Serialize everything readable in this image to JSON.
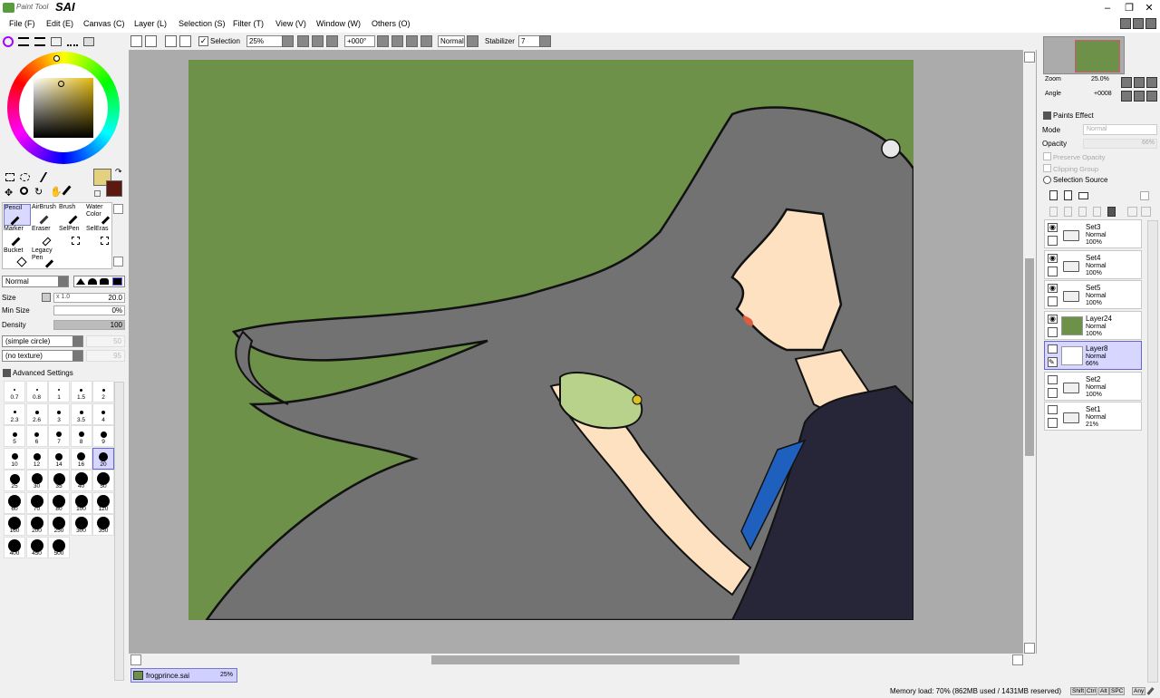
{
  "app": {
    "logo_text": "Paint Tool",
    "logo_brand": "SAI",
    "minimize": "–",
    "restore": "❐",
    "close": "✕"
  },
  "menu": [
    "File (F)",
    "Edit (E)",
    "Canvas (C)",
    "Layer (L)",
    "Selection (S)",
    "Filter (T)",
    "View (V)",
    "Window (W)",
    "Others (O)"
  ],
  "toolbar": {
    "selection_label": "Selection",
    "zoom": "25%",
    "angle": "+000°",
    "blend": "Normal",
    "stabilizer_label": "Stabilizer",
    "stabilizer": "7"
  },
  "tools": {
    "row1": [
      "Pencil",
      "AirBrush",
      "Brush",
      "Water Color"
    ],
    "row2": [
      "Marker",
      "Eraser",
      "SelPen",
      "SelEras"
    ],
    "row3": [
      "Bucket",
      "Legacy Pen"
    ]
  },
  "brush": {
    "blend_mode": "Normal",
    "size_label": "Size",
    "size_mult": "x 1.0",
    "size": "20.0",
    "min_size_label": "Min Size",
    "min_size": "0%",
    "density_label": "Density",
    "density": "100",
    "shape": "(simple circle)",
    "shape_val": "50",
    "texture": "(no texture)",
    "texture_val": "95",
    "advanced": "Advanced Settings"
  },
  "brush_sizes": [
    "0.7",
    "0.8",
    "1",
    "1.5",
    "2",
    "2.3",
    "2.6",
    "3",
    "3.5",
    "4",
    "5",
    "6",
    "7",
    "8",
    "9",
    "10",
    "12",
    "14",
    "16",
    "20",
    "25",
    "30",
    "35",
    "40",
    "50",
    "60",
    "70",
    "80",
    "100",
    "120",
    "160",
    "200",
    "250",
    "300",
    "350",
    "400",
    "450",
    "500"
  ],
  "selected_brush_size": "20",
  "navigator": {
    "zoom_label": "Zoom",
    "zoom": "25.0%",
    "angle_label": "Angle",
    "angle": "+0008"
  },
  "layer_props": {
    "paints_effect": "Paints Effect",
    "mode_label": "Mode",
    "mode": "Normal",
    "opacity_label": "Opacity",
    "opacity": "66%",
    "preserve": "Preserve Opacity",
    "clipping": "Clipping Group",
    "selection_source": "Selection Source"
  },
  "layers": [
    {
      "name": "Set3",
      "mode": "Normal",
      "opacity": "100%",
      "type": "folder",
      "visible": true
    },
    {
      "name": "Set4",
      "mode": "Normal",
      "opacity": "100%",
      "type": "folder",
      "visible": true
    },
    {
      "name": "Set5",
      "mode": "Normal",
      "opacity": "100%",
      "type": "folder",
      "visible": true
    },
    {
      "name": "Layer24",
      "mode": "Normal",
      "opacity": "100%",
      "type": "fill",
      "visible": true
    },
    {
      "name": "Layer8",
      "mode": "Normal",
      "opacity": "66%",
      "type": "layer",
      "visible": false,
      "selected": true
    },
    {
      "name": "Set2",
      "mode": "Normal",
      "opacity": "100%",
      "type": "folder",
      "visible": false
    },
    {
      "name": "Set1",
      "mode": "Normal",
      "opacity": "21%",
      "type": "folder",
      "visible": false
    }
  ],
  "file_tab": {
    "name": "frogprince.sai",
    "zoom": "25%"
  },
  "status": {
    "memory": "Memory load: 70% (862MB used / 1431MB reserved)",
    "keys": [
      "Shift",
      "Ctrl",
      "Alt",
      "SPC",
      "Any"
    ]
  },
  "colors": {
    "primary": "#e3d17f",
    "secondary": "#5a1a12",
    "canvas_bg": "#6d9148",
    "hair": "#727272",
    "skin": "#fde1c1",
    "dress": "#262638",
    "frog": "#b8d28c",
    "accent": "#1f5fbe"
  }
}
